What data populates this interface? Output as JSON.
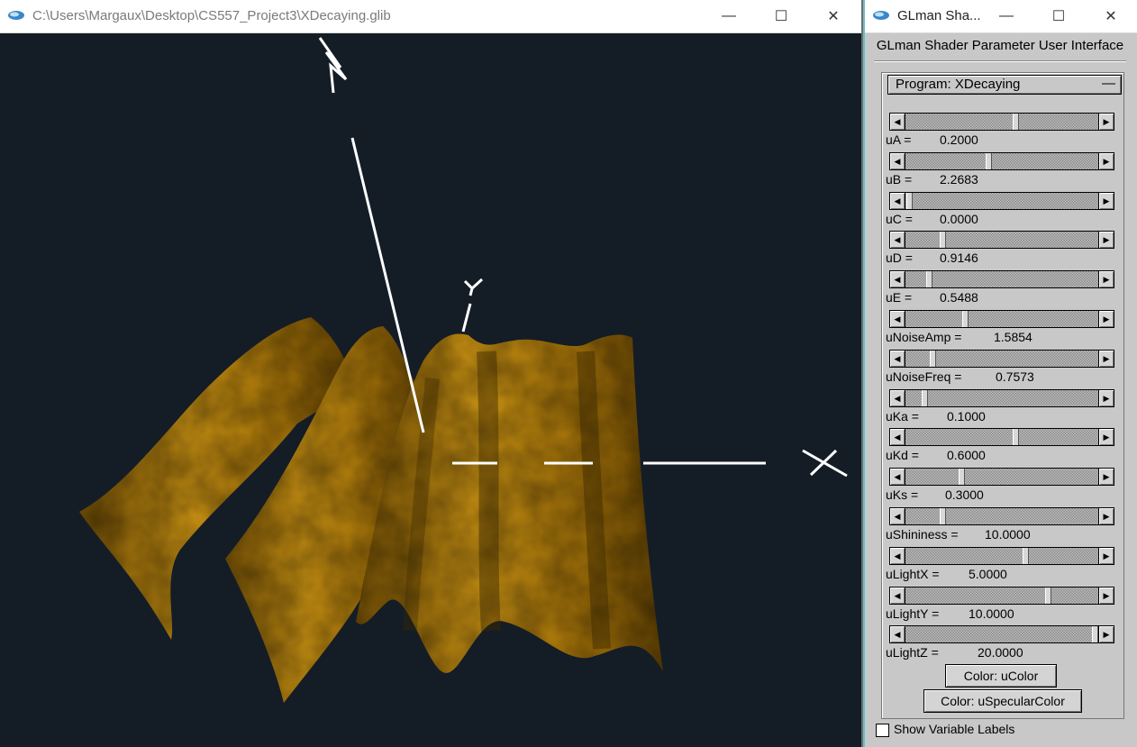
{
  "viewer_window": {
    "title": "C:\\Users\\Margaux\\Desktop\\CS557_Project3\\XDecaying.glib",
    "axis_labels": {
      "x": "X",
      "y": "Y",
      "z": "Z"
    },
    "surface_color": "#b8860b",
    "background_color": "#141d26"
  },
  "glman_window": {
    "title": "GLman Sha...",
    "heading": "GLman Shader Parameter User Interface",
    "program_label": "Program: XDecaying",
    "collapse_symbol": "—",
    "params": [
      {
        "label": "uA =",
        "value": "0.2000",
        "fraction": 0.57
      },
      {
        "label": "uB =",
        "value": "2.2683",
        "fraction": 0.43
      },
      {
        "label": "uC =",
        "value": "0.0000",
        "fraction": 0.02
      },
      {
        "label": "uD =",
        "value": "0.9146",
        "fraction": 0.19
      },
      {
        "label": "uE =",
        "value": "0.5488",
        "fraction": 0.12
      },
      {
        "label": "uNoiseAmp =",
        "value": "1.5854",
        "fraction": 0.31
      },
      {
        "label": "uNoiseFreq =",
        "value": "0.7573",
        "fraction": 0.14
      },
      {
        "label": "uKa =",
        "value": "0.1000",
        "fraction": 0.1
      },
      {
        "label": "uKd =",
        "value": "0.6000",
        "fraction": 0.57
      },
      {
        "label": "uKs =",
        "value": "0.3000",
        "fraction": 0.29
      },
      {
        "label": "uShininess =",
        "value": "10.0000",
        "fraction": 0.19
      },
      {
        "label": "uLightX =",
        "value": "5.0000",
        "fraction": 0.62
      },
      {
        "label": "uLightY =",
        "value": "10.0000",
        "fraction": 0.74
      },
      {
        "label": "uLightZ =",
        "value": "20.0000",
        "fraction": 0.98
      }
    ],
    "color_buttons": [
      "Color: uColor",
      "Color: uSpecularColor"
    ],
    "show_labels": "Show Variable Labels",
    "show_labels_checked": false
  },
  "window_controls": {
    "minimize": "—",
    "maximize": "☐",
    "close": "✕"
  }
}
